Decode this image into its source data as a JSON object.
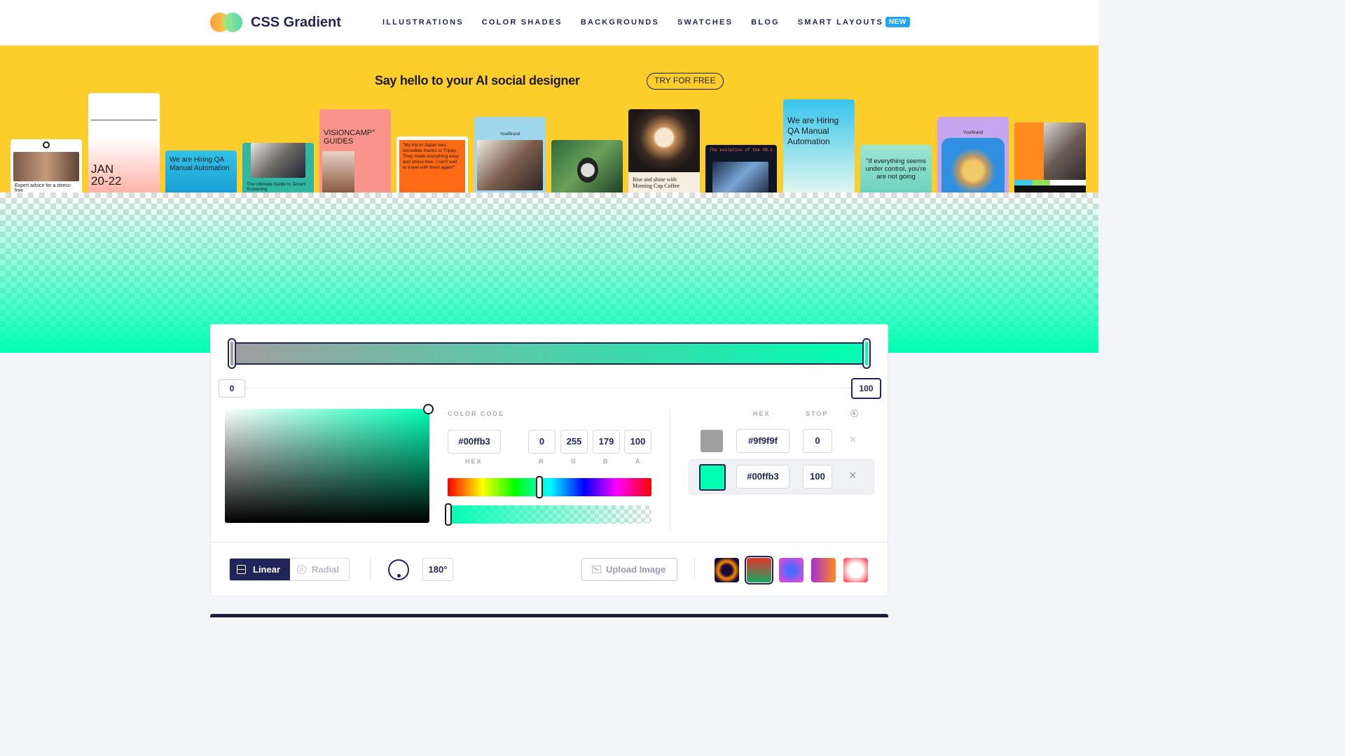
{
  "header": {
    "logo_text": "CSS Gradient",
    "nav": [
      "ILLUSTRATIONS",
      "COLOR SHADES",
      "BACKGROUNDS",
      "SWATCHES",
      "BLOG",
      "SMART LAYOUTS"
    ],
    "new_badge": "NEW"
  },
  "ad": {
    "headline": "Say hello to your AI social designer",
    "cta": "TRY FOR FREE",
    "cards": {
      "c1": "Expert advice for a stress-free",
      "c2_date": "JAN\n20-22",
      "c3": "We are Hiring QA Manual Automation",
      "c4": "The Ultimate Guide to Tenant Screening",
      "c5": "VISIONCAMP° GUIDES",
      "c6": "\"My trip to Japan was incredible thanks to Trippp. They made everything easy and stress-free. I can't wait to travel with them again!\"",
      "c7_brand": "YourBrand",
      "c9": "Rise and shine with Morning Cup Coffee",
      "c10": "The evolution of the VR-1",
      "c11": "We are Hiring QA Manual Automation",
      "c12": "\"If everything seems under control, you're are not going",
      "c13_brand": "YourBrand"
    }
  },
  "gradient": {
    "stops": [
      {
        "color": "#9f9f9f",
        "position": 0
      },
      {
        "color": "#00ffb3",
        "position": 100
      }
    ]
  },
  "picker": {
    "color_code_label": "COLOR CODE",
    "hex": "#00ffb3",
    "r": "0",
    "g": "255",
    "b": "179",
    "a": "100",
    "hex_label": "HEX",
    "r_label": "R",
    "g_label": "G",
    "b_label": "B",
    "a_label": "A",
    "hue_level_percent": 45,
    "alpha_level_percent": 100
  },
  "stops_table": {
    "hex_header": "HEX",
    "stop_header": "STOP",
    "rows": [
      {
        "hex": "#9f9f9f",
        "stop": "0",
        "color": "#9f9f9f"
      },
      {
        "hex": "#00ffb3",
        "stop": "100",
        "color": "#00ffb3"
      }
    ],
    "remove_glyph": "×"
  },
  "toolbar": {
    "linear": "Linear",
    "radial": "Radial",
    "angle": "180°",
    "upload": "Upload Image",
    "presets": [
      {
        "name": "preset-dark-orange",
        "colors": [
          "#ff8a00",
          "#1a0b3a"
        ]
      },
      {
        "name": "preset-red-green",
        "colors": [
          "#e8322a",
          "#17a864"
        ]
      },
      {
        "name": "preset-violet-blue",
        "colors": [
          "#d34bd6",
          "#4f6bff"
        ]
      },
      {
        "name": "preset-purple-orange",
        "colors": [
          "#a22fd6",
          "#ff8a1f"
        ]
      },
      {
        "name": "preset-red-white",
        "colors": [
          "#ffffff",
          "#ff4b5a"
        ]
      }
    ]
  },
  "colors": {
    "brand_navy": "#1f2459",
    "accent_green": "#00ffb3",
    "ad_yellow": "#fccd2b",
    "badge_blue": "#1ea7f0"
  }
}
